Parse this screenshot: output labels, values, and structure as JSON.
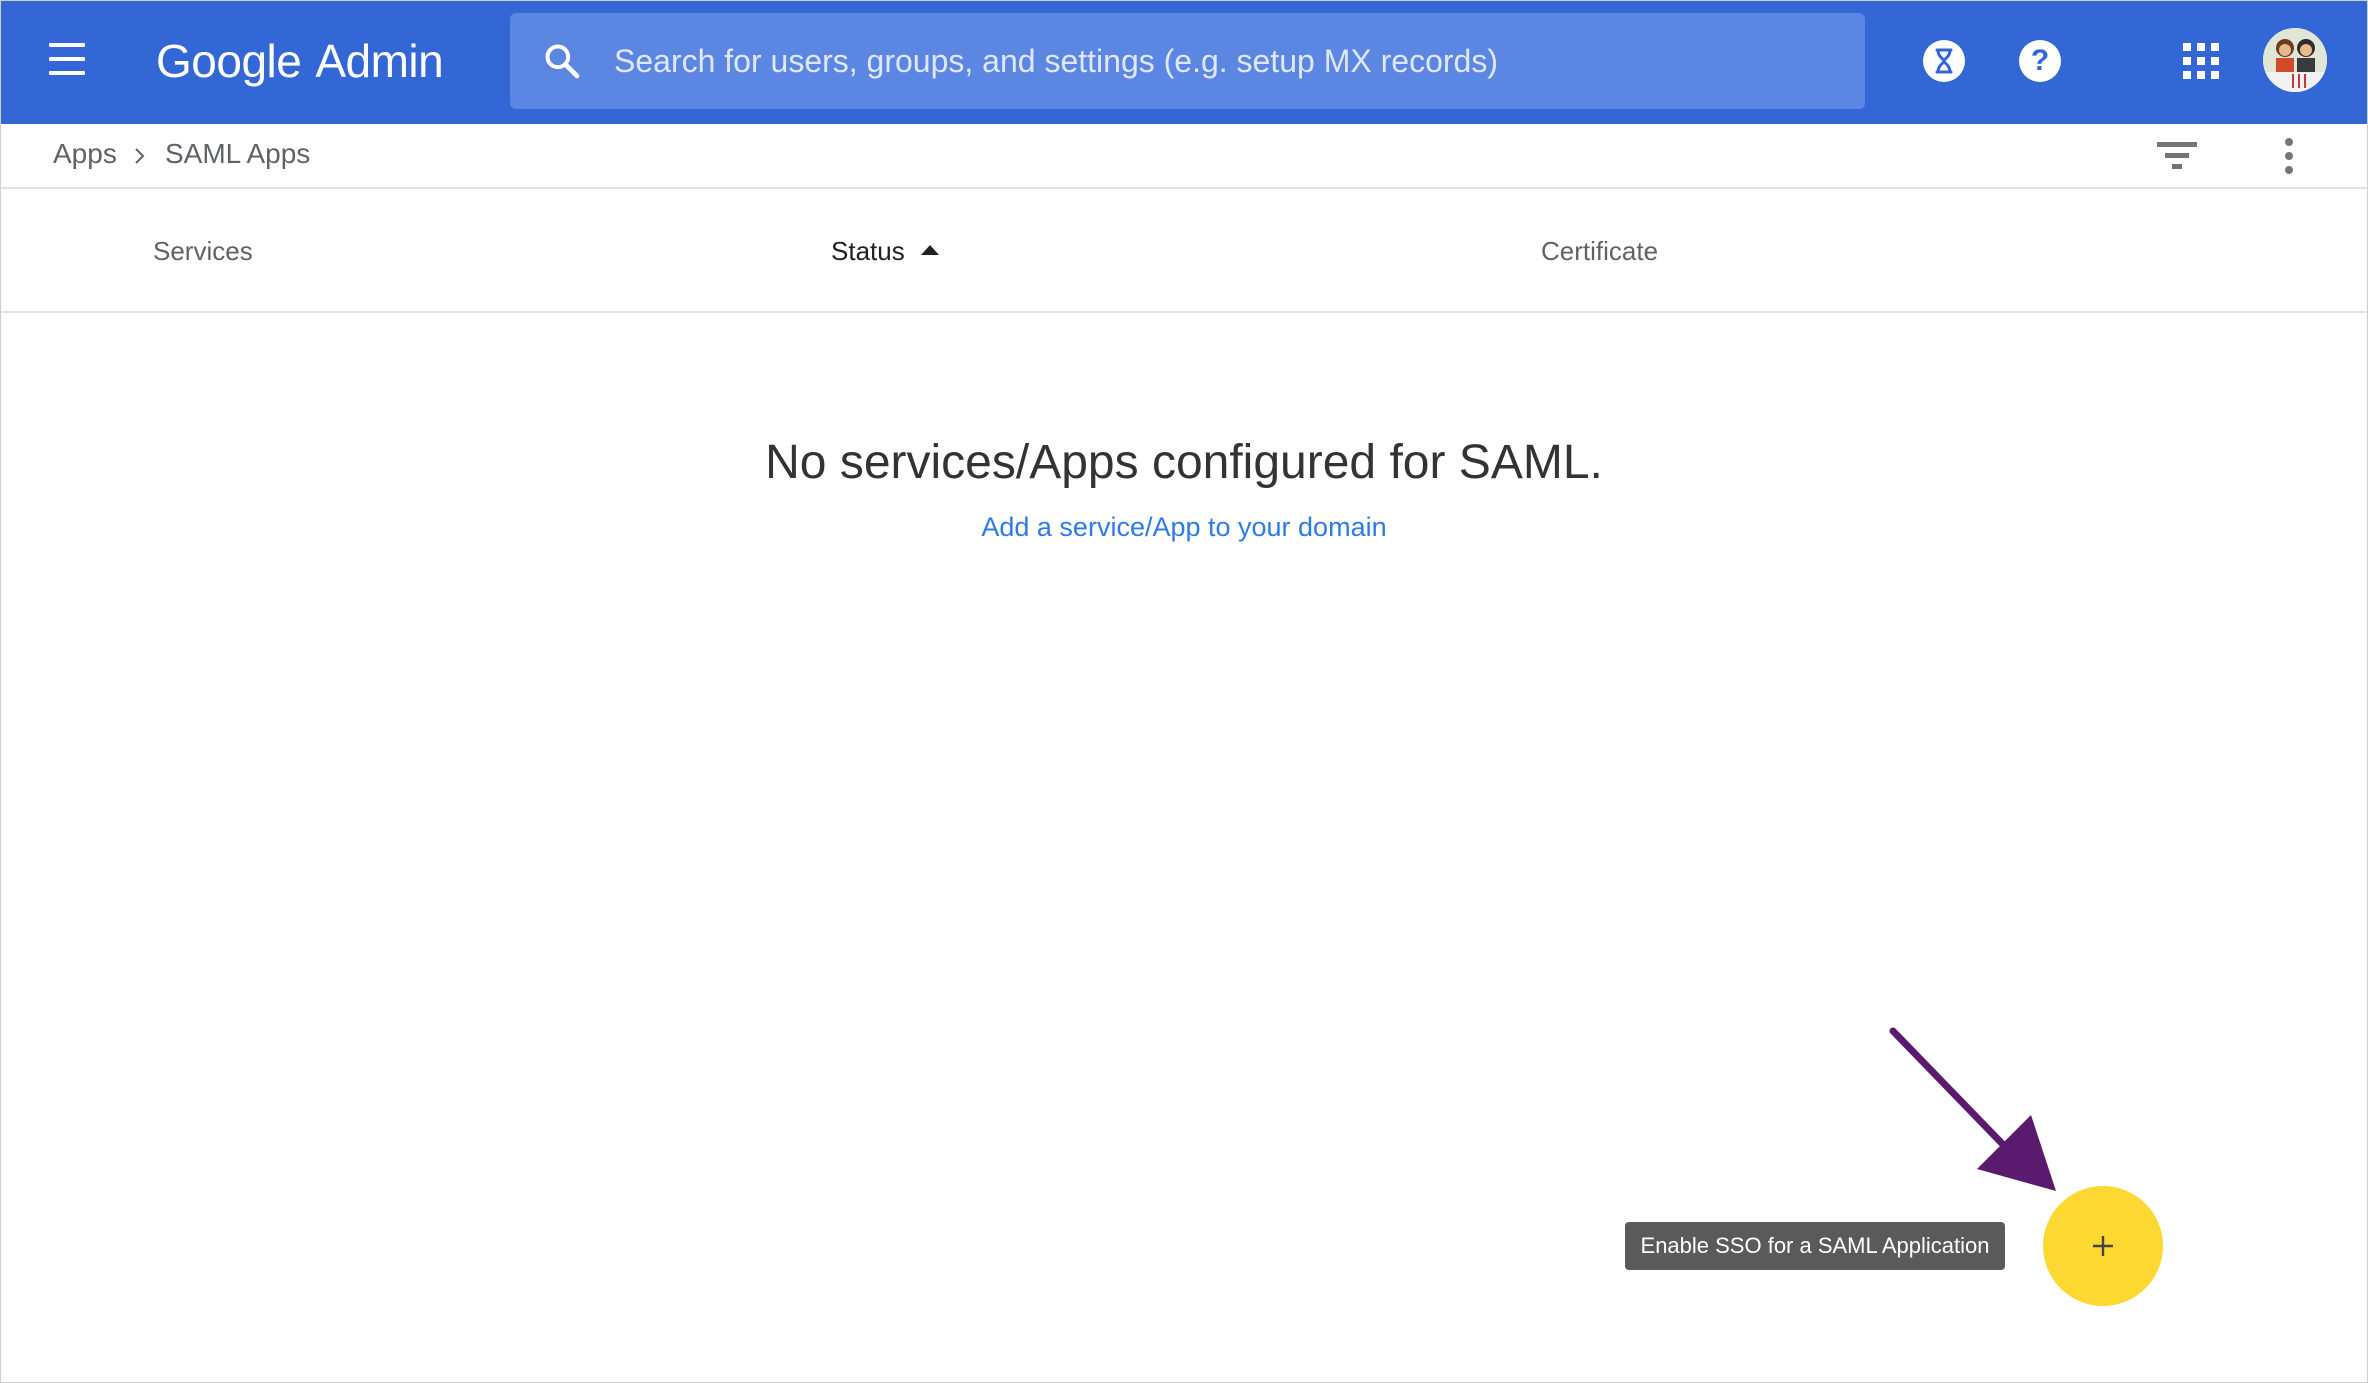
{
  "header": {
    "logo_google": "Google",
    "logo_admin": "Admin",
    "search_placeholder": "Search for users, groups, and settings (e.g. setup MX records)",
    "icons": [
      "menu-icon",
      "search-icon",
      "hourglass-icon",
      "help-icon",
      "apps-grid-icon",
      "avatar"
    ],
    "brand_color": "#3367d6"
  },
  "breadcrumb": {
    "items": [
      "Apps",
      "SAML Apps"
    ],
    "separator": ">"
  },
  "table": {
    "columns": [
      {
        "label": "Services",
        "sorted": false
      },
      {
        "label": "Status",
        "sorted": true,
        "direction": "ascending"
      },
      {
        "label": "Certificate",
        "sorted": false
      }
    ],
    "rows": []
  },
  "empty_state": {
    "title": "No services/Apps configured for SAML.",
    "link": "Add a service/App to your domain"
  },
  "fab": {
    "icon": "plus-icon",
    "tooltip": "Enable SSO for a SAML Application",
    "color": "#fcd830"
  },
  "annotation": {
    "arrow_color": "#5a1a6e"
  }
}
